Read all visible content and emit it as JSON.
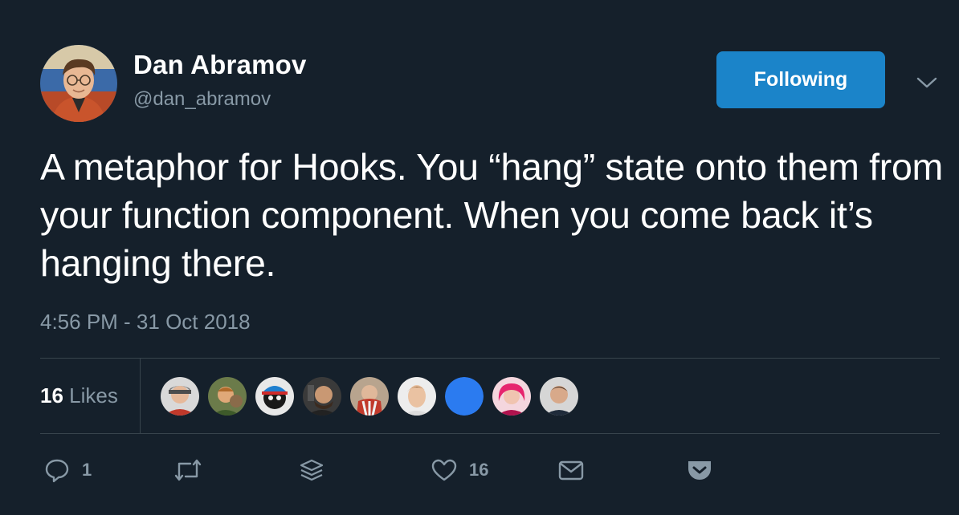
{
  "author": {
    "name": "Dan Abramov",
    "handle": "@dan_abramov",
    "avatar_icon": "profile-photo"
  },
  "follow_button": {
    "label": "Following",
    "color": "#1b84c9"
  },
  "menu": {
    "icon": "chevron-down-icon"
  },
  "tweet": {
    "text": "A metaphor for Hooks. You “hang” state onto them from your function component. When you come back it’s hanging there.",
    "timestamp": "4:56 PM - 31 Oct 2018"
  },
  "likes": {
    "count": "16",
    "label": "Likes",
    "avatars": [
      "liker-1",
      "liker-2",
      "liker-3",
      "liker-4",
      "liker-5",
      "liker-6",
      "liker-7",
      "liker-8",
      "liker-9"
    ]
  },
  "actions": {
    "reply": {
      "icon": "reply-icon",
      "count": "1"
    },
    "retweet": {
      "icon": "retweet-icon"
    },
    "stack": {
      "icon": "layers-icon"
    },
    "like": {
      "icon": "heart-icon",
      "count": "16"
    },
    "message": {
      "icon": "envelope-icon"
    },
    "pocket": {
      "icon": "pocket-icon"
    }
  },
  "colors": {
    "background": "#15202b",
    "secondary_text": "#8899a6",
    "divider": "#38444d"
  }
}
